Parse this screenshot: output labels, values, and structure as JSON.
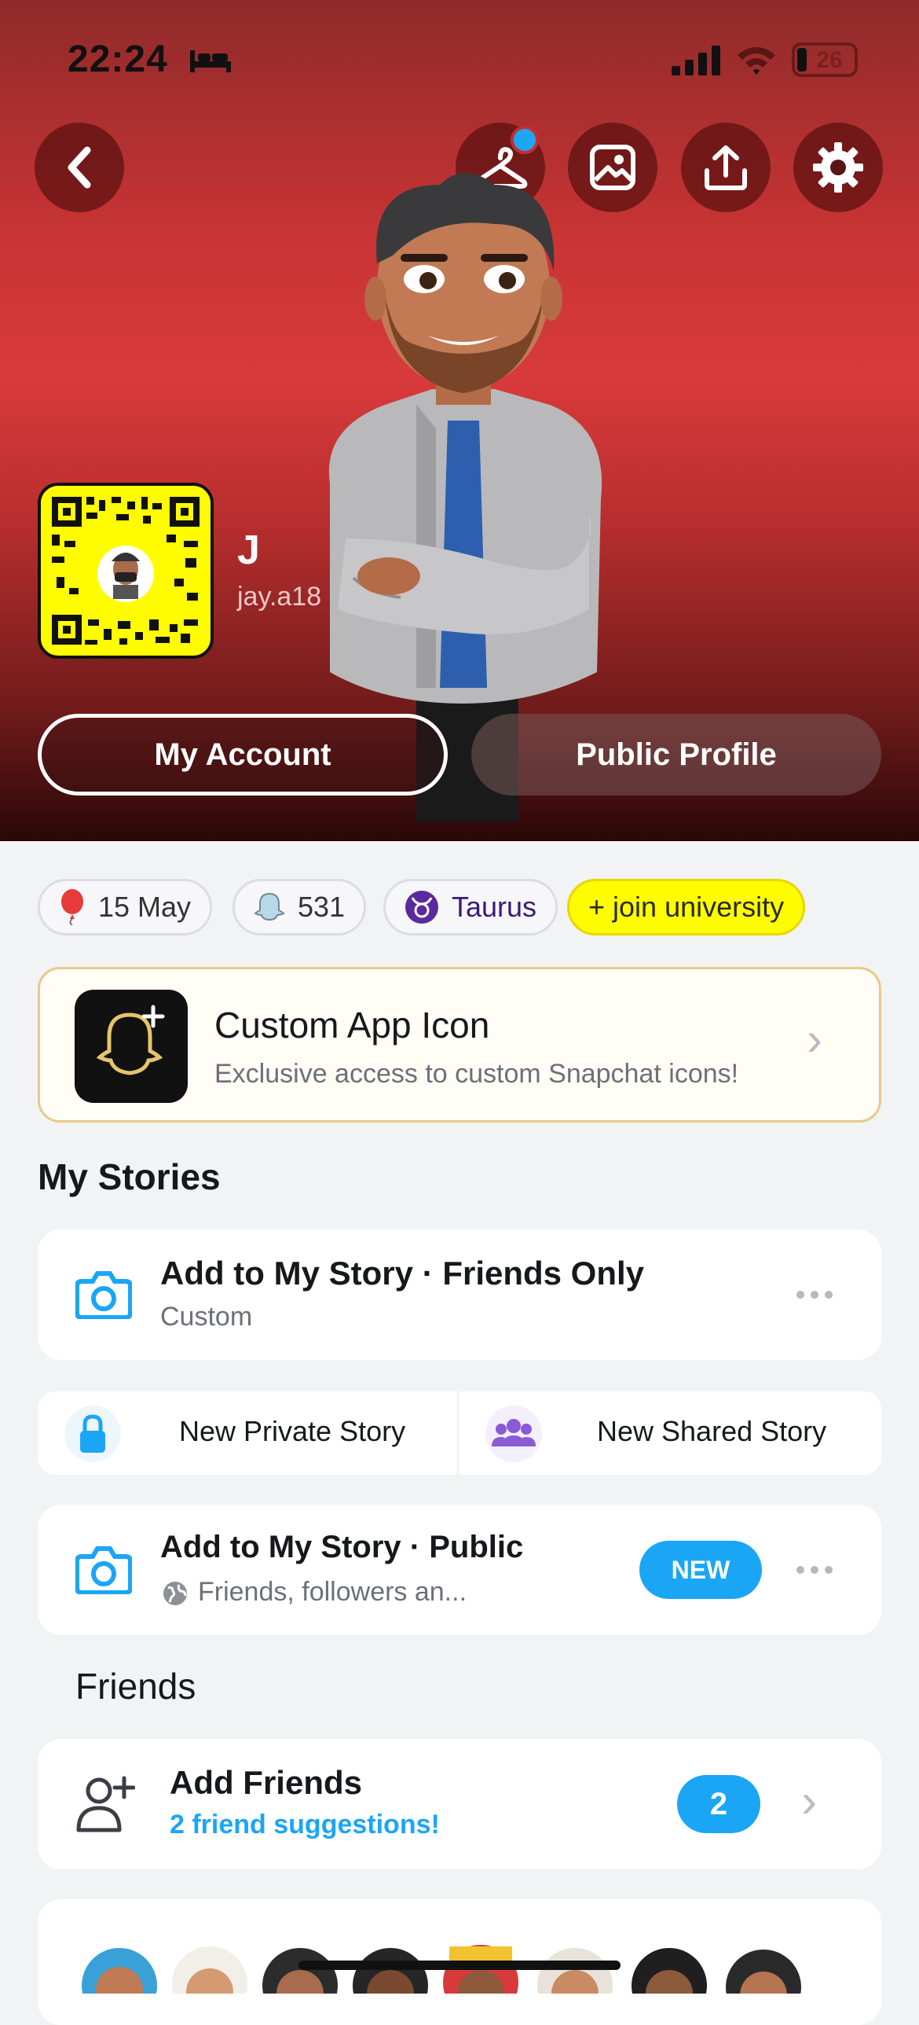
{
  "status_bar": {
    "time": "22:24",
    "battery": "26",
    "icons": [
      "bed-icon",
      "signal-icon",
      "wifi-icon",
      "battery-icon"
    ]
  },
  "header": {
    "nav_icons": [
      "back-icon",
      "hanger-icon",
      "image-icon",
      "share-icon",
      "gear-icon"
    ],
    "display_name": "J",
    "username": "jay.a18",
    "my_account_label": "My Account",
    "public_profile_label": "Public Profile"
  },
  "chips": {
    "birthday": "15 May",
    "snapscore": "531",
    "zodiac": "Taurus",
    "university": "+ join university"
  },
  "custom_app_icon": {
    "title": "Custom App Icon",
    "subtitle": "Exclusive access to custom Snapchat icons!"
  },
  "my_stories": {
    "heading": "My Stories",
    "friends_only": {
      "title": "Add to My Story · Friends Only",
      "subtitle": "Custom"
    },
    "private_story_label": "New Private Story",
    "shared_story_label": "New Shared Story",
    "public": {
      "title": "Add to My Story · Public",
      "subtitle": "Friends, followers an...",
      "badge": "NEW"
    }
  },
  "friends": {
    "heading": "Friends",
    "add_friends_title": "Add Friends",
    "add_friends_subtitle": "2 friend suggestions!",
    "count": "2"
  },
  "colors": {
    "header_red": "#d83a3a",
    "snap_yellow": "#fffc00",
    "accent_blue": "#1aa6f5",
    "background": "#f2f3f5"
  }
}
